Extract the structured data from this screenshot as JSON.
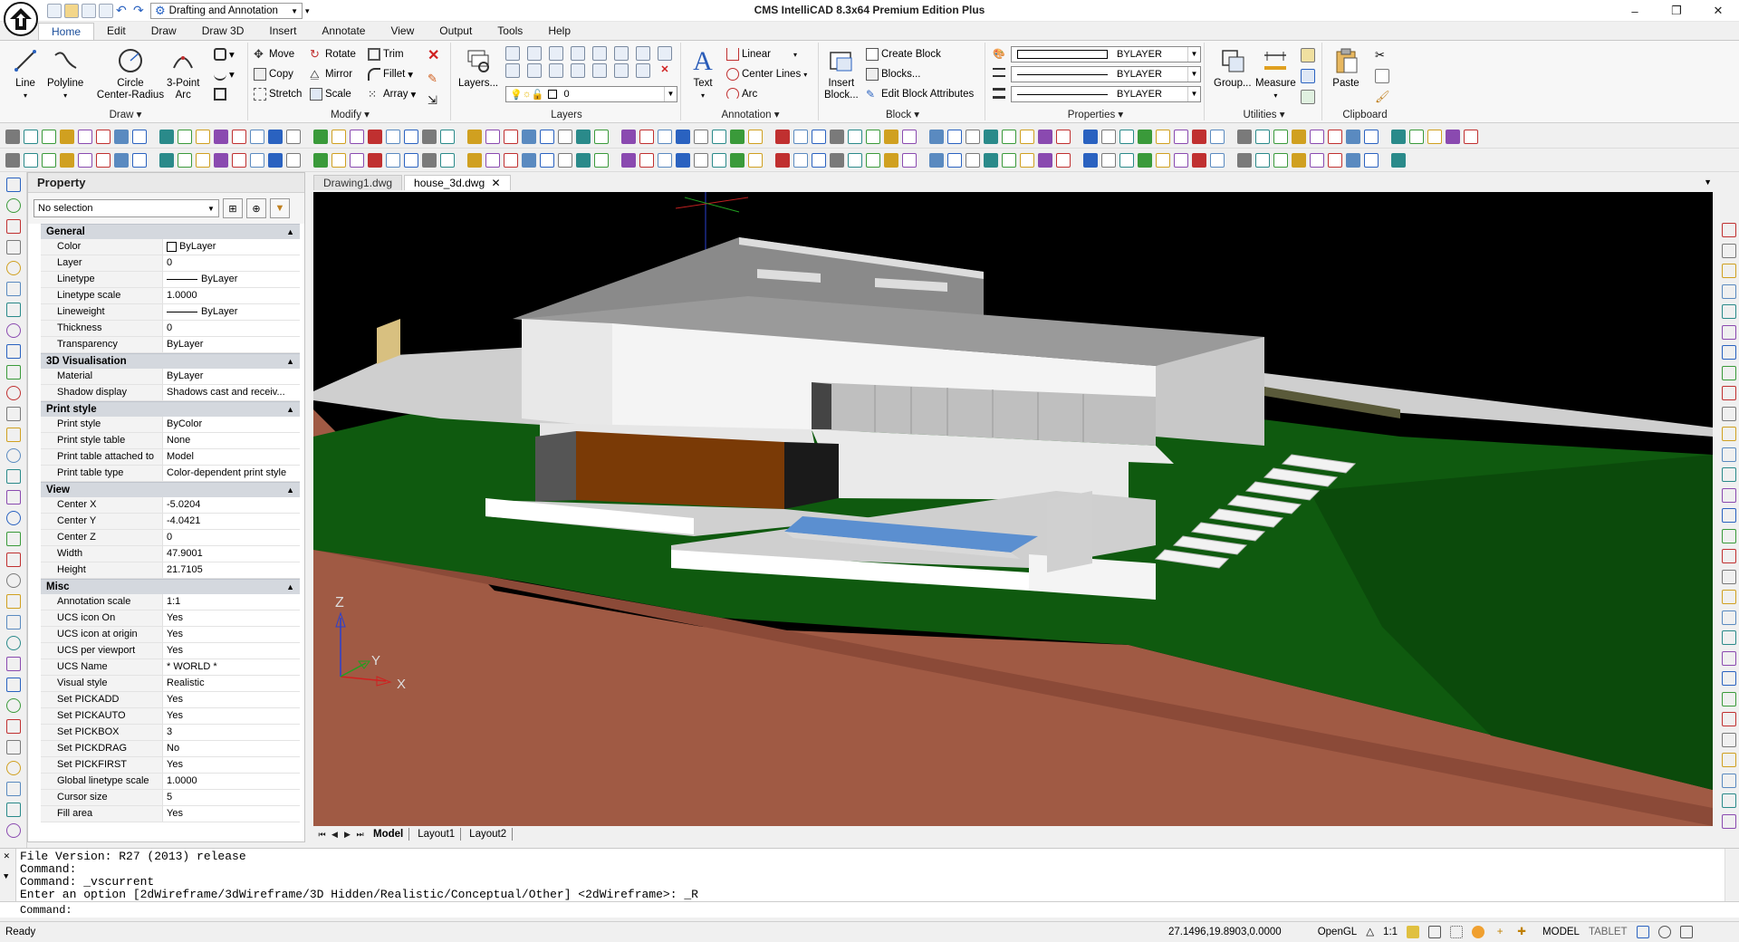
{
  "titlebar": {
    "title": "CMS IntelliCAD 8.3x64 Premium Edition Plus",
    "workspace": "Drafting and Annotation"
  },
  "menu": {
    "tabs": [
      "Home",
      "Edit",
      "Draw",
      "Draw 3D",
      "Insert",
      "Annotate",
      "View",
      "Output",
      "Tools",
      "Help"
    ]
  },
  "ribbon": {
    "draw": {
      "label": "Draw",
      "line": "Line",
      "polyline": "Polyline",
      "circle": "Circle\nCenter-Radius",
      "arc": "3-Point\nArc"
    },
    "modify": {
      "label": "Modify",
      "move": "Move",
      "rotate": "Rotate",
      "trim": "Trim",
      "copy": "Copy",
      "mirror": "Mirror",
      "fillet": "Fillet",
      "stretch": "Stretch",
      "scale": "Scale",
      "array": "Array"
    },
    "layers": {
      "label": "Layers",
      "layers_btn": "Layers...",
      "current": "0"
    },
    "annotation": {
      "label": "Annotation",
      "text": "Text",
      "linear": "Linear",
      "center_lines": "Center Lines",
      "arc": "Arc"
    },
    "block": {
      "label": "Block",
      "insert": "Insert\nBlock...",
      "create": "Create Block",
      "blocks": "Blocks...",
      "edit_attr": "Edit Block Attributes"
    },
    "properties": {
      "label": "Properties",
      "color": "BYLAYER",
      "linetype": "BYLAYER",
      "lineweight": "BYLAYER"
    },
    "utilities": {
      "label": "Utilities",
      "group": "Group...",
      "measure": "Measure"
    },
    "clipboard": {
      "label": "Clipboard",
      "paste": "Paste"
    }
  },
  "property_panel": {
    "title": "Property",
    "selection": "No selection",
    "sections": [
      {
        "name": "General",
        "rows": [
          [
            "Color",
            "ByLayer"
          ],
          [
            "Layer",
            "0"
          ],
          [
            "Linetype",
            "ByLayer"
          ],
          [
            "Linetype scale",
            "1.0000"
          ],
          [
            "Lineweight",
            "ByLayer"
          ],
          [
            "Thickness",
            "0"
          ],
          [
            "Transparency",
            "ByLayer"
          ]
        ]
      },
      {
        "name": "3D Visualisation",
        "rows": [
          [
            "Material",
            "ByLayer"
          ],
          [
            "Shadow display",
            "Shadows cast and receiv..."
          ]
        ]
      },
      {
        "name": "Print style",
        "rows": [
          [
            "Print style",
            "ByColor"
          ],
          [
            "Print style table",
            "None"
          ],
          [
            "Print table attached to",
            "Model"
          ],
          [
            "Print table type",
            "Color-dependent print style"
          ]
        ]
      },
      {
        "name": "View",
        "rows": [
          [
            "Center X",
            "-5.0204"
          ],
          [
            "Center Y",
            "-4.0421"
          ],
          [
            "Center Z",
            "0"
          ],
          [
            "Width",
            "47.9001"
          ],
          [
            "Height",
            "21.7105"
          ]
        ]
      },
      {
        "name": "Misc",
        "rows": [
          [
            "Annotation scale",
            "1:1"
          ],
          [
            "UCS icon On",
            "Yes"
          ],
          [
            "UCS icon at origin",
            "Yes"
          ],
          [
            "UCS per viewport",
            "Yes"
          ],
          [
            "UCS Name",
            "* WORLD *"
          ],
          [
            "Visual style",
            "Realistic"
          ],
          [
            "Set PICKADD",
            "Yes"
          ],
          [
            "Set PICKAUTO",
            "Yes"
          ],
          [
            "Set PICKBOX",
            "3"
          ],
          [
            "Set PICKDRAG",
            "No"
          ],
          [
            "Set PICKFIRST",
            "Yes"
          ],
          [
            "Global linetype scale",
            "1.0000"
          ],
          [
            "Cursor size",
            "5"
          ],
          [
            "Fill area",
            "Yes"
          ]
        ]
      }
    ]
  },
  "drawing_tabs": [
    "Drawing1.dwg",
    "house_3d.dwg"
  ],
  "layout_tabs": [
    "Model",
    "Layout1",
    "Layout2"
  ],
  "ucs": {
    "x": "X",
    "y": "Y",
    "z": "Z"
  },
  "command": {
    "lines": [
      "File Version: R27 (2013) release",
      "Command:",
      "Command: _vscurrent",
      "Enter an option [2dWireframe/3dWireframe/3D Hidden/Realistic/Conceptual/Other] <2dWireframe>: _R"
    ],
    "prompt": "Command:"
  },
  "status": {
    "ready": "Ready",
    "coords": "27.1496,19.8903,0.0000",
    "renderer": "OpenGL",
    "scale": "1:1",
    "model": "MODEL",
    "tablet": "TABLET"
  },
  "colors": {
    "accent": "#1b4e9b",
    "viewport_bg": "#000000",
    "grass": "#0f5a0f",
    "soil": "#a05a44",
    "pool": "#5b8fd0",
    "wood": "#7a3a06"
  }
}
